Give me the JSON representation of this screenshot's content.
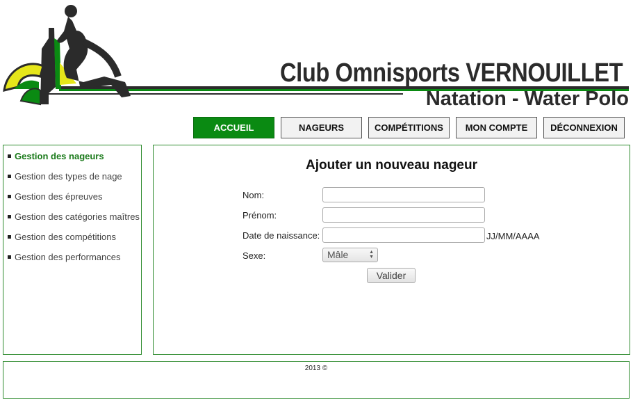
{
  "header": {
    "title": "Club Omnisports  VERNOUILLET",
    "subtitle": "Natation - Water Polo",
    "logo_icon": "water-polo-player-logo",
    "colors": {
      "green": "#0a8a12",
      "yellow": "#e6e61a",
      "dark": "#2b2b2b"
    }
  },
  "nav": {
    "items": [
      {
        "label": "ACCUEIL",
        "active": true
      },
      {
        "label": "NAGEURS",
        "active": false
      },
      {
        "label": "COMPÉTITIONS",
        "active": false
      },
      {
        "label": "MON COMPTE",
        "active": false
      },
      {
        "label": "DÉCONNEXION",
        "active": false
      }
    ]
  },
  "sidebar": {
    "items": [
      {
        "label": "Gestion des nageurs",
        "active": true
      },
      {
        "label": "Gestion des types de nage",
        "active": false
      },
      {
        "label": "Gestion des épreuves",
        "active": false
      },
      {
        "label": "Gestion des catégories maîtres",
        "active": false
      },
      {
        "label": "Gestion des compétitions",
        "active": false
      },
      {
        "label": "Gestion des performances",
        "active": false
      }
    ]
  },
  "form": {
    "title": "Ajouter un nouveau nageur",
    "nom_label": "Nom:",
    "nom_value": "",
    "prenom_label": "Prénom:",
    "prenom_value": "",
    "birth_label": "Date de naissance:",
    "birth_value": "",
    "birth_hint": "JJ/MM/AAAA",
    "sexe_label": "Sexe:",
    "sexe_value": "Mâle",
    "submit_label": "Valider"
  },
  "footer": {
    "text": "2013 ©"
  }
}
